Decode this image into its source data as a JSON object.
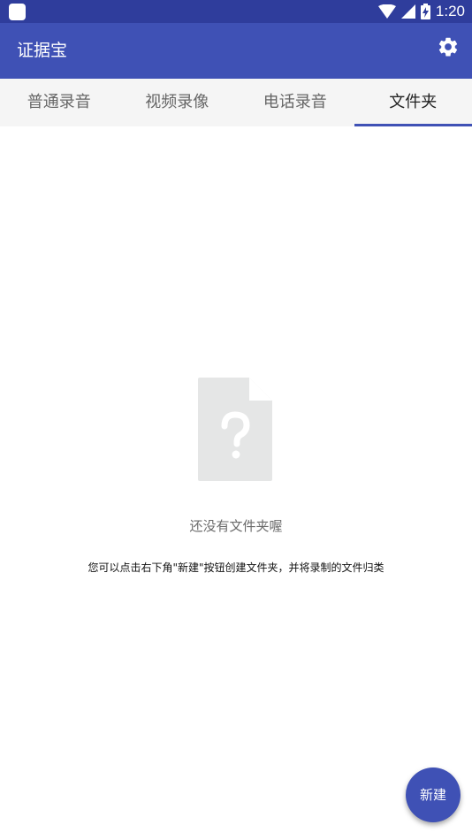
{
  "status_bar": {
    "time": "1:20",
    "icons": [
      "notification-icon",
      "wifi-icon",
      "signal-icon",
      "battery-charging-icon"
    ]
  },
  "app_bar": {
    "title": "证据宝",
    "settings_icon": "gear-icon"
  },
  "tabs": [
    {
      "label": "普通录音",
      "active": false
    },
    {
      "label": "视频录像",
      "active": false
    },
    {
      "label": "电话录音",
      "active": false
    },
    {
      "label": "文件夹",
      "active": true
    }
  ],
  "empty_state": {
    "icon": "unknown-file-icon",
    "title": "还没有文件夹喔",
    "hint": "您可以点击右下角\"新建\"按钮创建文件夹，并将录制的文件归类"
  },
  "fab": {
    "label": "新建"
  },
  "colors": {
    "status_bar": "#2f3d9c",
    "primary": "#3f51b5",
    "tab_bar": "#f5f5f5",
    "empty_icon": "#e5e6e6"
  }
}
